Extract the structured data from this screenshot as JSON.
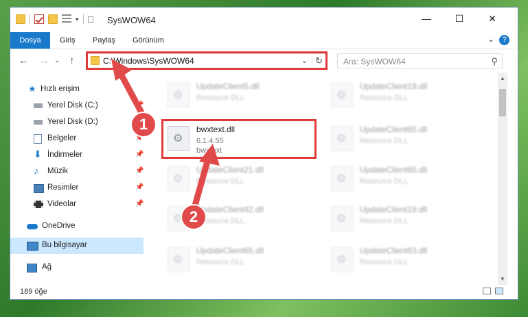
{
  "window": {
    "title": "SysWOW64",
    "minimize": "—",
    "maximize": "☐",
    "close": "✕"
  },
  "ribbon": {
    "tabs": [
      "Dosya",
      "Giriş",
      "Paylaş",
      "Görünüm"
    ],
    "help": "?",
    "expand": "⌄"
  },
  "nav": {
    "back": "←",
    "forward": "→",
    "recent": "⌄",
    "up": "↑",
    "address": "C:\\Windows\\SysWOW64",
    "address_dropdown": "⌄",
    "refresh": "↻",
    "search_placeholder": "Ara: SysWOW64",
    "search_icon": "⚲"
  },
  "sidebar": {
    "items": [
      {
        "label": "Hızlı erişim",
        "icon": "star-icon"
      },
      {
        "label": "Yerel Disk (C:)",
        "icon": "drive-icon",
        "pinned": true
      },
      {
        "label": "Yerel Disk (D:)",
        "icon": "drive-icon",
        "pinned": true
      },
      {
        "label": "Belgeler",
        "icon": "documents-icon",
        "pinned": true
      },
      {
        "label": "İndirmeler",
        "icon": "downloads-icon",
        "pinned": true
      },
      {
        "label": "Müzik",
        "icon": "music-icon",
        "pinned": true
      },
      {
        "label": "Resimler",
        "icon": "pictures-icon",
        "pinned": true
      },
      {
        "label": "Videolar",
        "icon": "videos-icon",
        "pinned": true
      },
      {
        "label": "OneDrive",
        "icon": "onedrive-icon"
      },
      {
        "label": "Bu bilgisayar",
        "icon": "computer-icon",
        "selected": true
      },
      {
        "label": "Ağ",
        "icon": "network-icon"
      }
    ],
    "pin_glyph": "📌"
  },
  "files": [
    {
      "name": "UpdateClient5.dll",
      "sub": "Resource DLL"
    },
    {
      "name": "UpdateClient19.dll",
      "sub": "Resource DLL"
    },
    {
      "name": "bwxtext.dll",
      "version": "6.1.4.55",
      "sub": "bwxtext",
      "highlighted": true
    },
    {
      "name": "UpdateClient65.dll",
      "sub": "Resource DLL"
    },
    {
      "name": "UpdateClient21.dll",
      "sub": "Resource DLL"
    },
    {
      "name": "UpdateClient65.dll",
      "sub": "Resource DLL"
    },
    {
      "name": "UpdateClient42.dll",
      "sub": "Resource DLL"
    },
    {
      "name": "UpdateClient19.dll",
      "sub": "Resource DLL"
    },
    {
      "name": "UpdateClient65.dll",
      "sub": "Resource DLL"
    },
    {
      "name": "UpdateClient63.dll",
      "sub": "Resource DLL"
    }
  ],
  "status": {
    "count": "189 öğe"
  },
  "badges": {
    "one": "1",
    "two": "2"
  },
  "colors": {
    "accent": "#1979ca",
    "highlight": "#e03b3b",
    "selected_bg": "#cce8ff"
  }
}
